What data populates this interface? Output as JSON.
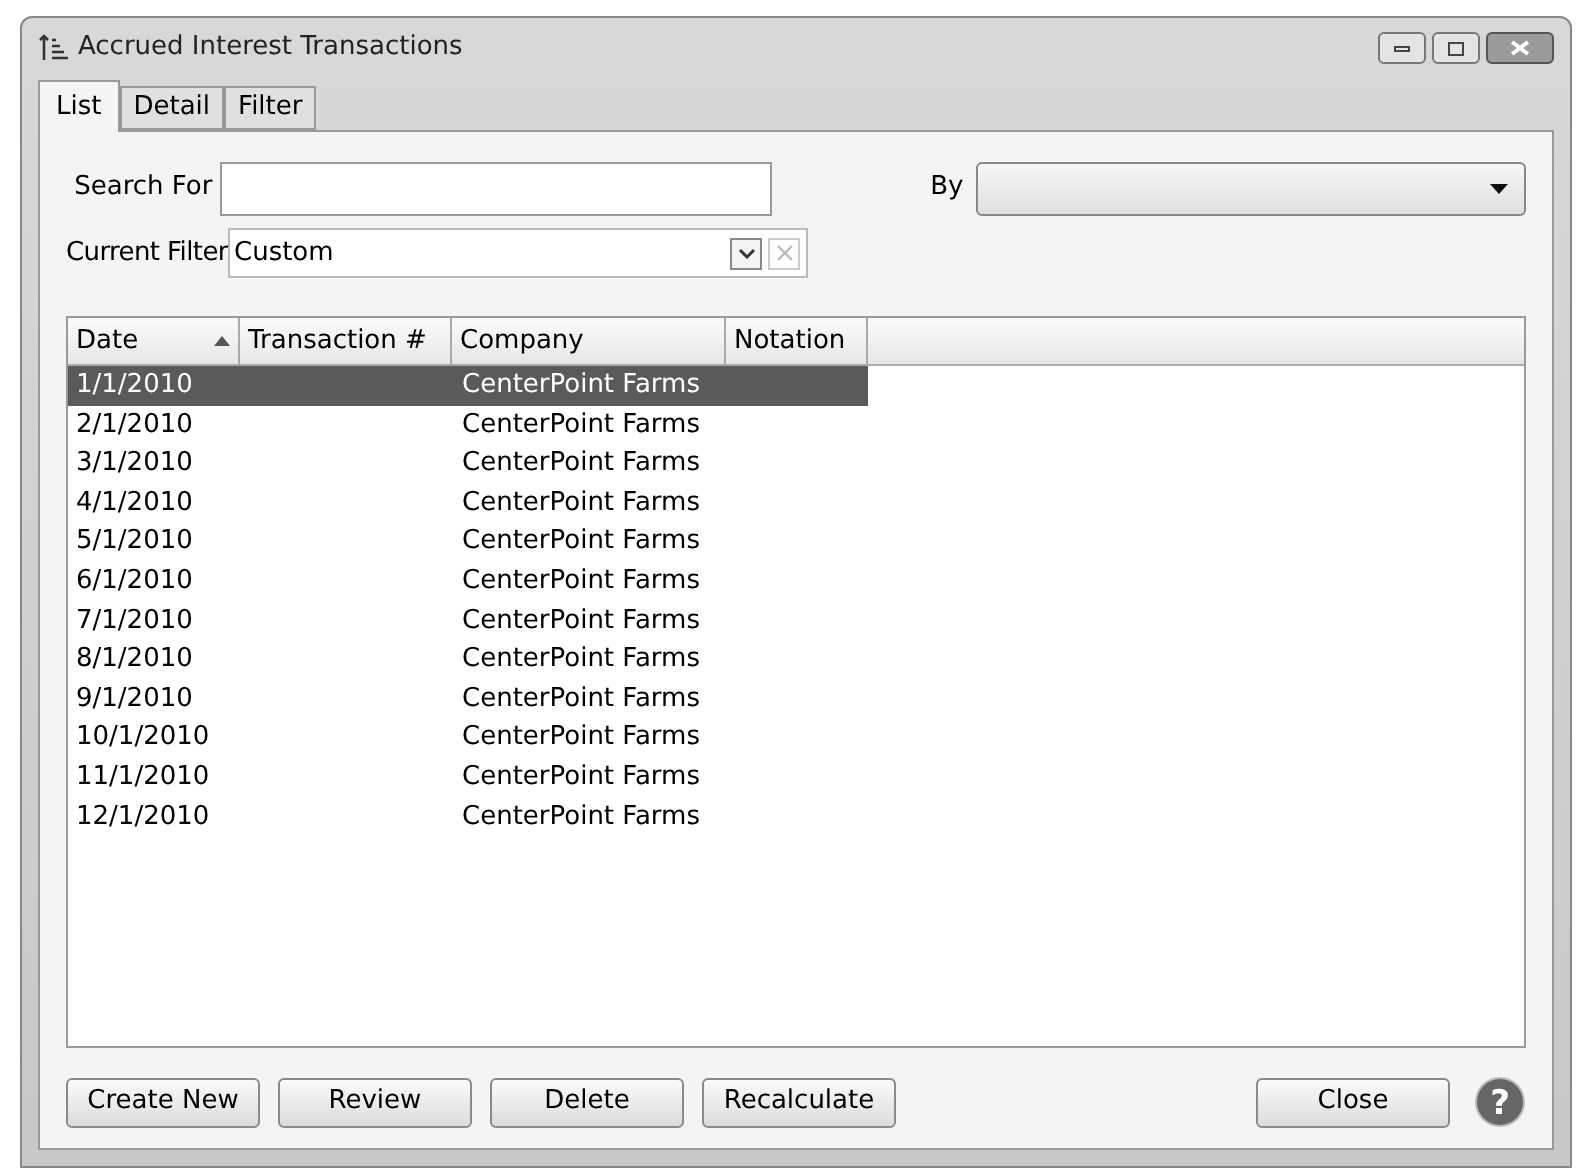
{
  "window": {
    "title": "Accrued Interest Transactions"
  },
  "tabs": [
    {
      "label": "List",
      "selected": true
    },
    {
      "label": "Detail",
      "selected": false
    },
    {
      "label": "Filter",
      "selected": false
    }
  ],
  "search": {
    "label": "Search For",
    "by_label": "By"
  },
  "filter": {
    "label": "Current Filter",
    "value": "Custom"
  },
  "table": {
    "columns": [
      {
        "label": "Date",
        "sorted": true
      },
      {
        "label": "Transaction #",
        "sorted": false
      },
      {
        "label": "Company",
        "sorted": false
      },
      {
        "label": "Notation",
        "sorted": false
      }
    ],
    "rows": [
      {
        "date": "1/1/2010",
        "company": "CenterPoint Farms",
        "selected": true
      },
      {
        "date": "2/1/2010",
        "company": "CenterPoint Farms",
        "selected": false
      },
      {
        "date": "3/1/2010",
        "company": "CenterPoint Farms",
        "selected": false
      },
      {
        "date": "4/1/2010",
        "company": "CenterPoint Farms",
        "selected": false
      },
      {
        "date": "5/1/2010",
        "company": "CenterPoint Farms",
        "selected": false
      },
      {
        "date": "6/1/2010",
        "company": "CenterPoint Farms",
        "selected": false
      },
      {
        "date": "7/1/2010",
        "company": "CenterPoint Farms",
        "selected": false
      },
      {
        "date": "8/1/2010",
        "company": "CenterPoint Farms",
        "selected": false
      },
      {
        "date": "9/1/2010",
        "company": "CenterPoint Farms",
        "selected": false
      },
      {
        "date": "10/1/2010",
        "company": "CenterPoint Farms",
        "selected": false
      },
      {
        "date": "11/1/2010",
        "company": "CenterPoint Farms",
        "selected": false
      },
      {
        "date": "12/1/2010",
        "company": "CenterPoint Farms",
        "selected": false
      }
    ]
  },
  "buttons": [
    "Create New",
    "Review",
    "Delete",
    "Recalculate"
  ],
  "close_button": "Close",
  "help_icon": "?"
}
